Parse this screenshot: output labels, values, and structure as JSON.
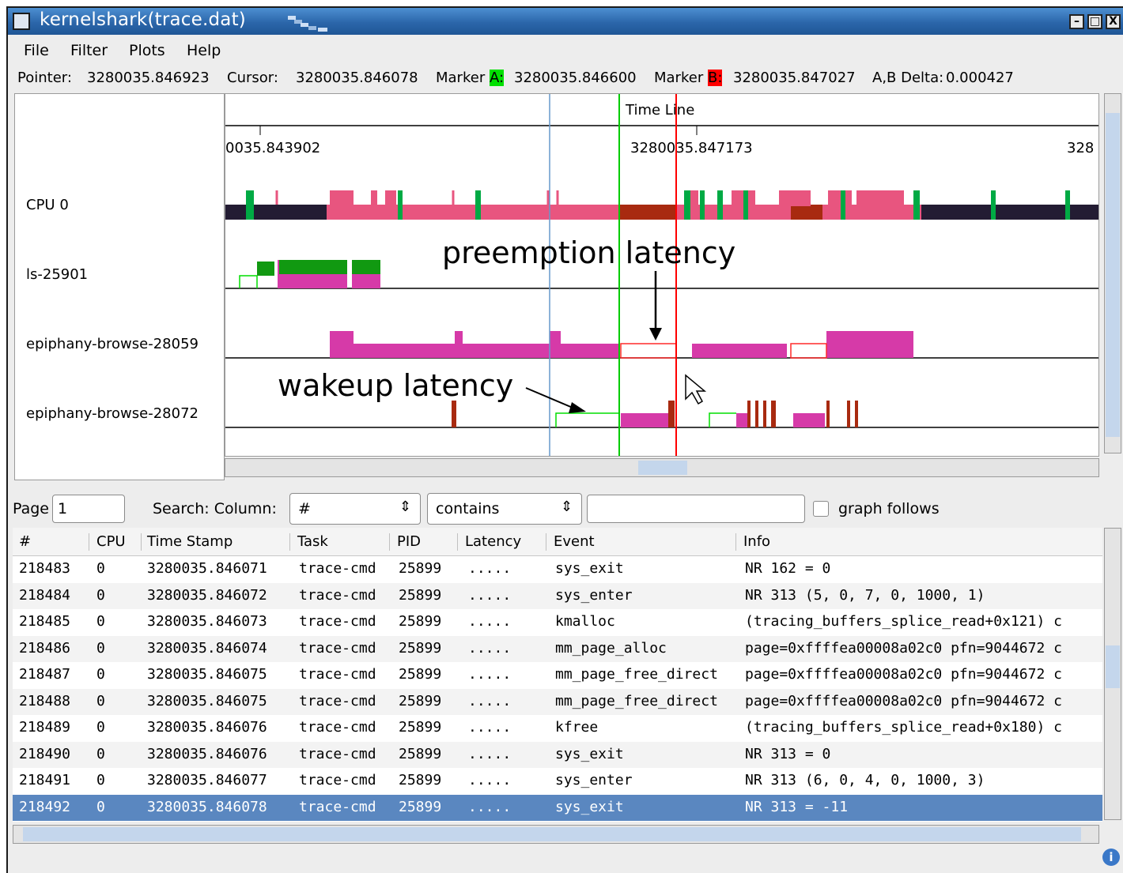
{
  "window": {
    "title": "kernelshark(trace.dat)",
    "minimize": "–",
    "maximize": "□",
    "close": "X"
  },
  "menu": [
    "File",
    "Filter",
    "Plots",
    "Help"
  ],
  "info": {
    "pointer_label": "Pointer:",
    "pointer": "3280035.846923",
    "cursor_label": "Cursor:",
    "cursor": "3280035.846078",
    "markerA_label": "Marker",
    "markerA_tag": "A:",
    "markerA": "3280035.846600",
    "markerB_label": "Marker",
    "markerB_tag": "B:",
    "markerB": "3280035.847027",
    "delta_label": "A,B Delta:",
    "delta": "0.000427",
    "markerA_color": "#00e000",
    "markerB_color": "#ff0000"
  },
  "graph": {
    "timeline_label": "Time Line",
    "ticks": [
      "0035.843902",
      "3280035.847173",
      "328"
    ],
    "plots": [
      "CPU 0",
      "ls-25901",
      "epiphany-browse-28059",
      "epiphany-browse-28072"
    ],
    "annotations": {
      "preemption": "preemption latency",
      "wakeup": "wakeup latency"
    }
  },
  "controls": {
    "page_label": "Page",
    "page_value": "1",
    "search_label": "Search: Column:",
    "column_value": "#",
    "match_value": "contains",
    "search_text": "",
    "graph_follows": "graph follows"
  },
  "table": {
    "columns": [
      "#",
      "CPU",
      "Time Stamp",
      "Task",
      "PID",
      "Latency",
      "Event",
      "Info"
    ],
    "rows": [
      [
        "218483",
        "0",
        "3280035.846071",
        "trace-cmd",
        "25899",
        ".....",
        "sys_exit",
        "NR 162 = 0"
      ],
      [
        "218484",
        "0",
        "3280035.846072",
        "trace-cmd",
        "25899",
        ".....",
        "sys_enter",
        "NR 313 (5, 0, 7, 0, 1000, 1)"
      ],
      [
        "218485",
        "0",
        "3280035.846073",
        "trace-cmd",
        "25899",
        ".....",
        "kmalloc",
        "(tracing_buffers_splice_read+0x121) c"
      ],
      [
        "218486",
        "0",
        "3280035.846074",
        "trace-cmd",
        "25899",
        ".....",
        "mm_page_alloc",
        "page=0xffffea00008a02c0 pfn=9044672 c"
      ],
      [
        "218487",
        "0",
        "3280035.846075",
        "trace-cmd",
        "25899",
        ".....",
        "mm_page_free_direct",
        "page=0xffffea00008a02c0 pfn=9044672 c"
      ],
      [
        "218488",
        "0",
        "3280035.846075",
        "trace-cmd",
        "25899",
        ".....",
        "mm_page_free_direct",
        "page=0xffffea00008a02c0 pfn=9044672 c"
      ],
      [
        "218489",
        "0",
        "3280035.846076",
        "trace-cmd",
        "25899",
        ".....",
        "kfree",
        "(tracing_buffers_splice_read+0x180) c"
      ],
      [
        "218490",
        "0",
        "3280035.846076",
        "trace-cmd",
        "25899",
        ".....",
        "sys_exit",
        "NR 313 = 0"
      ],
      [
        "218491",
        "0",
        "3280035.846077",
        "trace-cmd",
        "25899",
        ".....",
        "sys_enter",
        "NR 313 (6, 0, 4, 0, 1000, 3)"
      ],
      [
        "218492",
        "0",
        "3280035.846078",
        "trace-cmd",
        "25899",
        ".....",
        "sys_exit",
        "NR 313 = -11"
      ]
    ],
    "selected_row": 9
  },
  "colors": {
    "title_bar": "#2b66aa",
    "selection": "#5a87c0",
    "cpu_task": "#e8557f",
    "task_run": "#d63aa8",
    "idle": "#231c33",
    "wakeup": "#00cc00",
    "cursor": "#00cc00",
    "marker_b": "#ff0000",
    "pointer": "#6699cc"
  }
}
